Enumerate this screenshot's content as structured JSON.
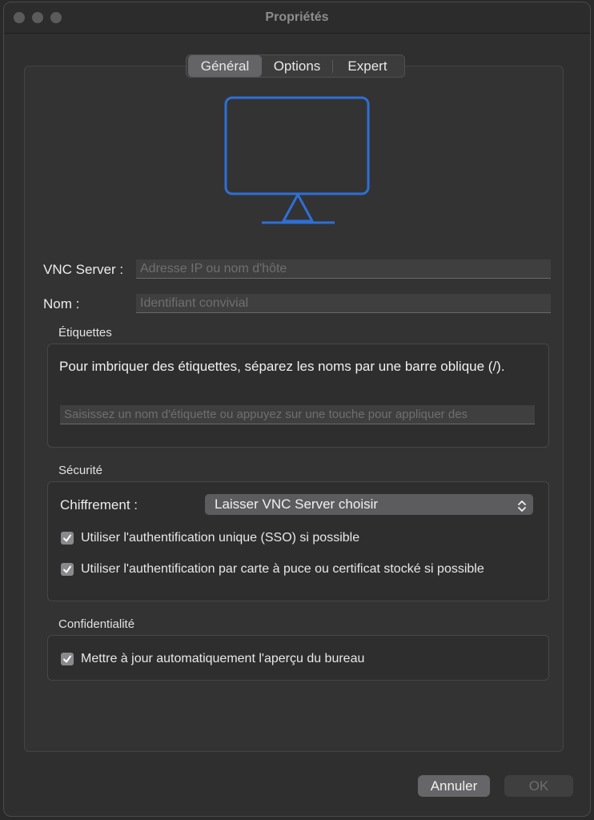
{
  "window": {
    "title": "Propriétés"
  },
  "tabs": [
    {
      "label": "Général",
      "selected": true
    },
    {
      "label": "Options",
      "selected": false
    },
    {
      "label": "Expert",
      "selected": false
    }
  ],
  "colors": {
    "accent": "#2f6fd6",
    "window_bg": "#2f2f30",
    "checkbox": "#8a8a8c"
  },
  "general": {
    "monitor_icon": "monitor-icon",
    "vnc_server": {
      "label": "VNC Server :",
      "value": "",
      "placeholder": "Adresse IP ou nom d'hôte"
    },
    "name": {
      "label": "Nom :",
      "value": "",
      "placeholder": "Identifiant convivial"
    }
  },
  "tags": {
    "title": "Étiquettes",
    "hint": "Pour imbriquer des étiquettes, séparez les noms par une barre oblique (/).",
    "input_placeholder": "Saisissez un nom d'étiquette ou appuyez sur une touche pour appliquer des"
  },
  "security": {
    "title": "Sécurité",
    "encryption_label": "Chiffrement :",
    "encryption_value": "Laisser VNC Server choisir",
    "sso_label": "Utiliser l'authentification unique (SSO) si possible",
    "sso_checked": true,
    "smartcard_label": "Utiliser l'authentification par carte à puce ou certificat stocké si possible",
    "smartcard_checked": true
  },
  "privacy": {
    "title": "Confidentialité",
    "preview_label": "Mettre à jour automatiquement l'aperçu du bureau",
    "preview_checked": true
  },
  "footer": {
    "cancel_label": "Annuler",
    "ok_label": "OK",
    "ok_enabled": false
  }
}
